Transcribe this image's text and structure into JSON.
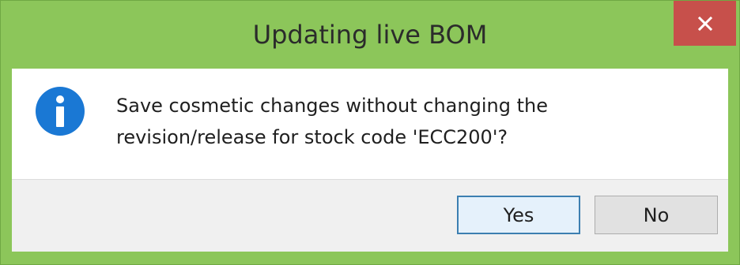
{
  "dialog": {
    "title": "Updating live BOM",
    "close_icon": "close-icon",
    "message_icon": "info-icon",
    "message_lines": [
      "Save cosmetic changes without changing the",
      "revision/release for stock code 'ECC200'?"
    ],
    "buttons": {
      "yes_label": "Yes",
      "no_label": "No"
    }
  },
  "colors": {
    "frame": "#8cc65a",
    "close_button": "#c7504b",
    "info_icon": "#1a78d4",
    "footer": "#f0f0f0",
    "default_button_border": "#3c7fb1"
  }
}
